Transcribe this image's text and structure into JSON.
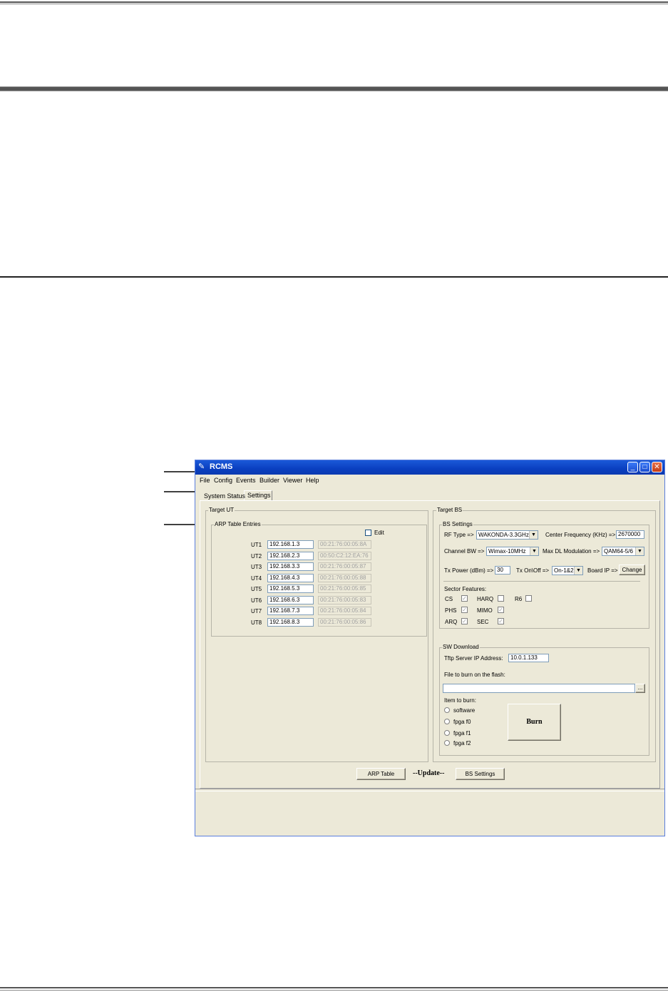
{
  "window": {
    "title": "RCMS",
    "menu": [
      "File",
      "Config",
      "Events",
      "Builder",
      "Viewer",
      "Help"
    ]
  },
  "tabs": [
    "System Status",
    "Settings"
  ],
  "target_ut": {
    "label": "Target UT",
    "arp": {
      "label": "ARP Table Entries",
      "edit_label": "Edit",
      "rows": [
        {
          "ut": "UT1",
          "ip": "192.168.1.3",
          "mac": "00:21:76:00:05:8A"
        },
        {
          "ut": "UT2",
          "ip": "192.168.2.3",
          "mac": "00:50:C2:12:EA:76"
        },
        {
          "ut": "UT3",
          "ip": "192.168.3.3",
          "mac": "00:21:76:00:05:87"
        },
        {
          "ut": "UT4",
          "ip": "192.168.4.3",
          "mac": "00:21:76:00:05:88"
        },
        {
          "ut": "UT5",
          "ip": "192.168.5.3",
          "mac": "00:21:76:00:05:85"
        },
        {
          "ut": "UT6",
          "ip": "192.168.6.3",
          "mac": "00:21:76:00:05:83"
        },
        {
          "ut": "UT7",
          "ip": "192.168.7.3",
          "mac": "00:21:76:00:05:84"
        },
        {
          "ut": "UT8",
          "ip": "192.168.8.3",
          "mac": "00:21:76:00:05:86"
        }
      ]
    }
  },
  "target_bs": {
    "label": "Target BS",
    "settings": {
      "label": "BS Settings",
      "rf_type_label": "RF Type =>",
      "rf_type_value": "WAKONDA-3.3GHz",
      "center_freq_label": "Center Frequency (KHz) =>",
      "center_freq_value": "2670000",
      "channel_bw_label": "Channel BW =>",
      "channel_bw_value": "Wimax-10MHz",
      "max_dl_label": "Max DL Modulation =>",
      "max_dl_value": "QAM64-5/6",
      "tx_power_label": "Tx Power (dBm) =>",
      "tx_power_value": "30",
      "tx_onoff_label": "Tx On\\Off =>",
      "tx_onoff_value": "On-1&2",
      "board_ip_label": "Board IP =>",
      "change_label": "Change",
      "sector_features_label": "Sector Features:",
      "features": [
        "CS",
        "HARQ",
        "R6",
        "PHS",
        "MIMO",
        "ARQ",
        "SEC"
      ]
    },
    "sw": {
      "label": "SW Download",
      "tftp_label": "Tftp Server IP Address:",
      "tftp_value": "10.0.1.133",
      "file_label": "File to burn on the flash:",
      "browse_label": "...",
      "item_label": "Item to burn:",
      "items": [
        "software",
        "fpga f0",
        "fpga f1",
        "fpga f2"
      ],
      "burn_label": "Burn"
    }
  },
  "bottom": {
    "arp_button": "ARP Table",
    "update_label": "--Update--",
    "bs_button": "BS Settings"
  }
}
